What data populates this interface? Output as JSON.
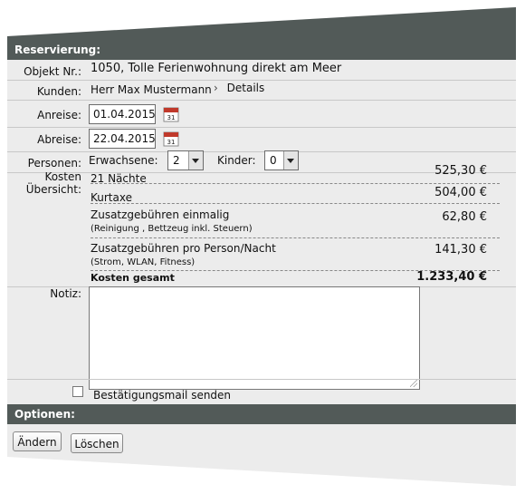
{
  "reservation": {
    "header": "Reservierung:",
    "object_label": "Objekt Nr.:",
    "object_value": "1050, Tolle Ferienwohnung direkt am Meer",
    "customer_label": "Kunden:",
    "customer_value": "Herr Max Mustermann",
    "details_link": "Details",
    "arrival_label": "Anreise:",
    "arrival_value": "01.04.2015",
    "departure_label": "Abreise:",
    "departure_value": "22.04.2015",
    "calendar_day": "31",
    "persons_label": "Personen:",
    "adults_label": "Erwachsene:",
    "adults_value": "2",
    "children_label": "Kinder:",
    "children_value": "0",
    "costs_label_line1": "Kosten",
    "costs_label_line2": "Übersicht:",
    "costs": [
      {
        "label": "21 Nächte",
        "sub": "",
        "amount": "525,30 €"
      },
      {
        "label": "Kurtaxe",
        "sub": "",
        "amount": "504,00 €"
      },
      {
        "label": "Zusatzgebühren einmalig",
        "sub": "(Reinigung , Bettzeug inkl. Steuern)",
        "amount": "62,80 €"
      },
      {
        "label": "Zusatzgebühren pro Person/Nacht",
        "sub": "(Strom, WLAN, Fitness)",
        "amount": "141,30 €"
      }
    ],
    "total_label": "Kosten gesamt",
    "total_amount": "1.233,40 €",
    "note_label": "Notiz:",
    "note_value": "",
    "confirm_label": "Bestätigungsmail senden"
  },
  "options": {
    "header": "Optionen:",
    "change_button": "Ändern",
    "delete_button": "Löschen"
  },
  "colors": {
    "header_bg": "#525a58",
    "panel_bg": "#ececec",
    "calendar_red": "#c0392b"
  }
}
